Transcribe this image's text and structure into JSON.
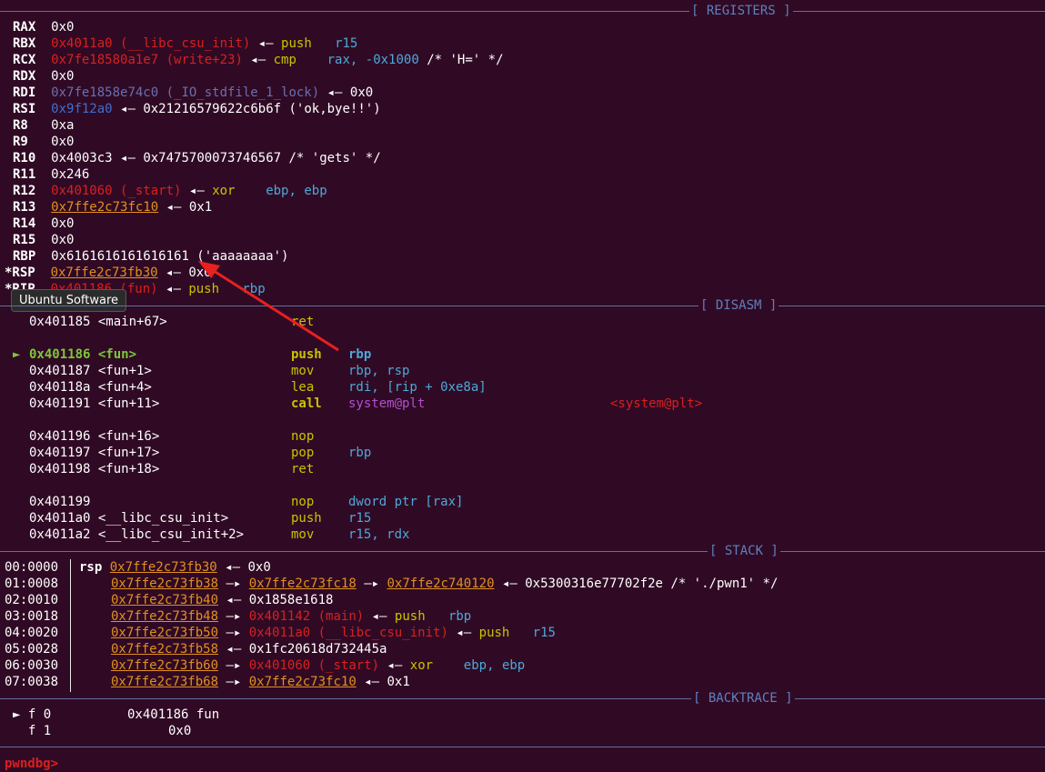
{
  "sections": {
    "registers": "[ REGISTERS ]",
    "disasm": "[ DISASM ]",
    "stack": "[ STACK ]",
    "backtrace": "[ BACKTRACE ]"
  },
  "registers": [
    {
      "name": "RAX",
      "value": "0x0"
    },
    {
      "name": "RBX",
      "value": "0x4011a0 (__libc_csu_init)",
      "arrow": "◂—",
      "inst": "push",
      "ops": "r15"
    },
    {
      "name": "RCX",
      "value": "0x7fe18580a1e7 (write+23)",
      "arrow": "◂—",
      "inst": "cmp",
      "ops": "rax, -0x1000",
      "comment": "/* 'H=' */"
    },
    {
      "name": "RDX",
      "value": "0x0"
    },
    {
      "name": "RDI",
      "value": "0x7fe1858e74c0 (_IO_stdfile_1_lock)",
      "arrow": "◂—",
      "rest": "0x0"
    },
    {
      "name": "RSI",
      "value": "0x9f12a0",
      "arrow": "◂—",
      "rest": "0x21216579622c6b6f ('ok,bye!!')"
    },
    {
      "name": "R8",
      "value": "0xa"
    },
    {
      "name": "R9",
      "value": "0x0"
    },
    {
      "name": "R10",
      "value": "0x4003c3",
      "arrow": "◂—",
      "rest": "0x7475700073746567 /* 'gets' */"
    },
    {
      "name": "R11",
      "value": "0x246"
    },
    {
      "name": "R12",
      "value": "0x401060 (_start)",
      "arrow": "◂—",
      "inst": "xor",
      "ops": "ebp, ebp"
    },
    {
      "name": "R13",
      "value": "0x7ffe2c73fc10",
      "arrow": "◂—",
      "rest": "0x1"
    },
    {
      "name": "R14",
      "value": "0x0"
    },
    {
      "name": "R15",
      "value": "0x0"
    },
    {
      "name": "RBP",
      "value": "0x6161616161616161 ('aaaaaaaa')"
    },
    {
      "name": "*RSP",
      "value": "0x7ffe2c73fb30",
      "arrow": "◂—",
      "rest": "0x0"
    },
    {
      "name": "*RIP",
      "value": "0x401186 (fun)",
      "arrow": "◂—",
      "inst": "push",
      "ops": "rbp"
    }
  ],
  "tooltip": "Ubuntu Software",
  "disasm": [
    {
      "addr": "0x401185 <main+67>",
      "inst": "ret",
      "ops": ""
    },
    {
      "addr": "0x401186 <fun>",
      "inst": "push",
      "ops": "rbp",
      "current": true,
      "marker": "►"
    },
    {
      "addr": "0x401187 <fun+1>",
      "inst": "mov",
      "ops": "rbp, rsp"
    },
    {
      "addr": "0x40118a <fun+4>",
      "inst": "lea",
      "ops": "rdi, [rip + 0xe8a]"
    },
    {
      "addr": "0x401191 <fun+11>",
      "inst": "call",
      "ops": "system@plt",
      "target": "<system@plt>"
    },
    {
      "addr": "0x401196 <fun+16>",
      "inst": "nop",
      "ops": ""
    },
    {
      "addr": "0x401197 <fun+17>",
      "inst": "pop",
      "ops": "rbp"
    },
    {
      "addr": "0x401198 <fun+18>",
      "inst": "ret",
      "ops": ""
    },
    {
      "addr": "0x401199",
      "inst": "nop",
      "ops": "dword ptr [rax]"
    },
    {
      "addr": "0x4011a0 <__libc_csu_init>",
      "inst": "push",
      "ops": "r15"
    },
    {
      "addr": "0x4011a2 <__libc_csu_init+2>",
      "inst": "mov",
      "ops": "r15, rdx"
    }
  ],
  "stack": [
    {
      "off": "00:0000",
      "label": "rsp",
      "addr": "0x7ffe2c73fb30",
      "arrow": "◂—",
      "rest": "0x0"
    },
    {
      "off": "01:0008",
      "addr": "0x7ffe2c73fb38",
      "arrow": "—▸",
      "p1": "0x7ffe2c73fc18",
      "p2": "0x7ffe2c740120",
      "rest": "0x5300316e77702f2e /* './pwn1' */"
    },
    {
      "off": "02:0010",
      "addr": "0x7ffe2c73fb40",
      "arrow": "◂—",
      "rest": "0x1858e1618"
    },
    {
      "off": "03:0018",
      "addr": "0x7ffe2c73fb48",
      "arrow": "—▸",
      "code": "0x401142 (main)",
      "inst": "push",
      "ops": "rbp"
    },
    {
      "off": "04:0020",
      "addr": "0x7ffe2c73fb50",
      "arrow": "—▸",
      "code": "0x4011a0 (__libc_csu_init)",
      "inst": "push",
      "ops": "r15"
    },
    {
      "off": "05:0028",
      "addr": "0x7ffe2c73fb58",
      "arrow": "◂—",
      "rest": "0x1fc20618d732445a"
    },
    {
      "off": "06:0030",
      "addr": "0x7ffe2c73fb60",
      "arrow": "—▸",
      "code": "0x401060 (_start)",
      "inst": "xor",
      "ops": "ebp, ebp"
    },
    {
      "off": "07:0038",
      "addr": "0x7ffe2c73fb68",
      "arrow": "—▸",
      "p1": "0x7ffe2c73fc10",
      "rest": "0x1"
    }
  ],
  "backtrace": [
    {
      "marker": "► f 0",
      "addr": "0x401186",
      "func": "fun"
    },
    {
      "marker": "  f 1",
      "addr": "0x0",
      "func": ""
    }
  ],
  "prompt": "pwndbg>",
  "colors": {
    "background": "#300a24",
    "separator": "#5f6fa0",
    "arrow": "#e82020"
  }
}
